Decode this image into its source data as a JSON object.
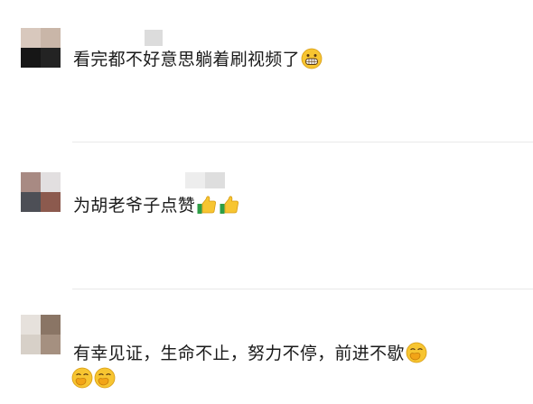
{
  "comments": [
    {
      "text": "看完都不好意思躺着刷视频了",
      "emojis": [
        "grinning-face-icon"
      ]
    },
    {
      "text": "为胡老爷子点赞",
      "emojis": [
        "thumbs-up-icon",
        "thumbs-up-icon"
      ]
    },
    {
      "text": "有幸见证，生命不止，努力不停，前进不歇",
      "emojis": [
        "face-with-hand-over-mouth-icon",
        "face-with-hand-over-mouth-icon",
        "face-with-hand-over-mouth-icon"
      ]
    }
  ],
  "colors": {
    "text": "#1a1a1a",
    "divider": "#e9e9e9",
    "emoji_yellow": "#f7c531",
    "thumb_green": "#2e9e46"
  }
}
